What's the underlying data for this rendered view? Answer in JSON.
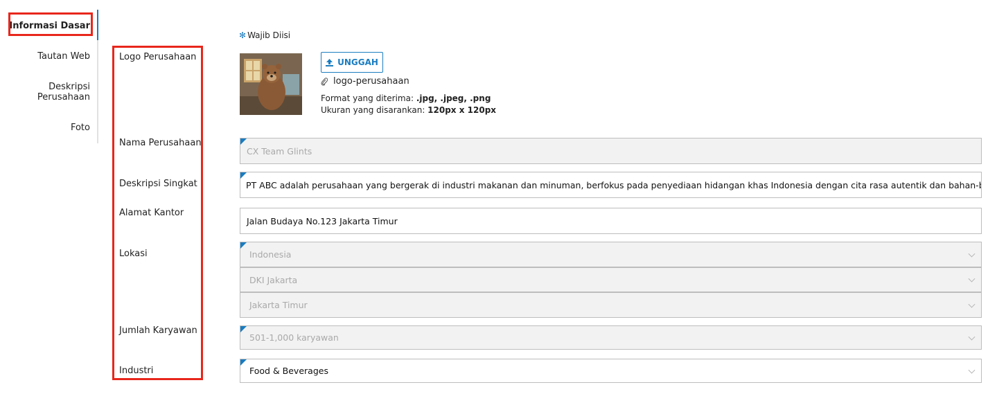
{
  "sidebar": {
    "items": [
      {
        "label": "Informasi Dasar",
        "active": true
      },
      {
        "label": "Tautan Web"
      },
      {
        "label": "Deskripsi\nPerusahaan"
      },
      {
        "label": "Foto"
      }
    ]
  },
  "form": {
    "required_note": "Wajib Diisi",
    "labels": {
      "logo": "Logo Perusahaan",
      "company_name": "Nama Perusahaan",
      "short_desc": "Deskripsi Singkat",
      "office_address": "Alamat Kantor",
      "location": "Lokasi",
      "employees": "Jumlah Karyawan",
      "industry": "Industri"
    },
    "upload_label": "UNGGAH",
    "file_name": "logo-perusahaan",
    "format_prefix": "Format yang diterima: ",
    "format_value": ".jpg, .jpeg, .png",
    "size_prefix": "Ukuran yang disarankan: ",
    "size_value": "120px x 120px",
    "company_name": "CX Team Glints",
    "short_desc": "PT ABC adalah perusahaan yang bergerak di industri makanan dan minuman, berfokus pada penyediaan hidangan khas Indonesia dengan cita rasa autentik dan bahan-baha",
    "office_address": "Jalan Budaya No.123 Jakarta Timur",
    "country": "Indonesia",
    "province": "DKI Jakarta",
    "city": "Jakarta Timur",
    "employees": "501-1,000 karyawan",
    "industry": "Food & Beverages"
  },
  "colors": {
    "accent": "#1a7cc0",
    "highlight": "#e8261b",
    "disabled_bg": "#f2f2f2"
  }
}
